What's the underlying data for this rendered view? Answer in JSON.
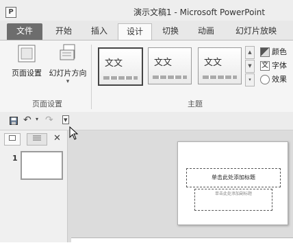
{
  "app": {
    "icon_text": "P",
    "window_title": "演示文稿1 - Microsoft PowerPoint"
  },
  "tabs": [
    {
      "label": "文件"
    },
    {
      "label": "开始"
    },
    {
      "label": "插入"
    },
    {
      "label": "设计",
      "active": true
    },
    {
      "label": "切换"
    },
    {
      "label": "动画"
    },
    {
      "label": "幻灯片放映"
    }
  ],
  "ribbon": {
    "page_setup_group": {
      "label": "页面设置",
      "buttons": [
        {
          "label": "页面设置",
          "icon": "page-setup-icon"
        },
        {
          "label": "幻灯片方向",
          "icon": "slide-orientation-icon",
          "dropdown_glyph": "▾"
        }
      ]
    },
    "themes_group": {
      "label": "主题",
      "themes": [
        {
          "text": "文文",
          "selected": true
        },
        {
          "text": "文文",
          "selected": false
        },
        {
          "text": "文文",
          "selected": false
        }
      ],
      "side_items": [
        {
          "label": "颜色",
          "icon": "colors-icon"
        },
        {
          "label": "字体",
          "icon": "fonts-icon",
          "icon_text": "文"
        },
        {
          "label": "效果",
          "icon": "effects-icon"
        }
      ]
    }
  },
  "qat": {
    "icons": [
      "save-icon",
      "undo-icon",
      "redo-icon",
      "customize-qat-icon"
    ],
    "undo_glyph": "↶",
    "undo_drop_glyph": "▾",
    "redo_glyph": "↷",
    "customize_glyph": "▾"
  },
  "left_panel": {
    "close_glyph": "✕",
    "slide_number": "1"
  },
  "slide": {
    "title_placeholder": "单击此处添加标题",
    "subtitle_placeholder": "单击此处添加副标题"
  }
}
